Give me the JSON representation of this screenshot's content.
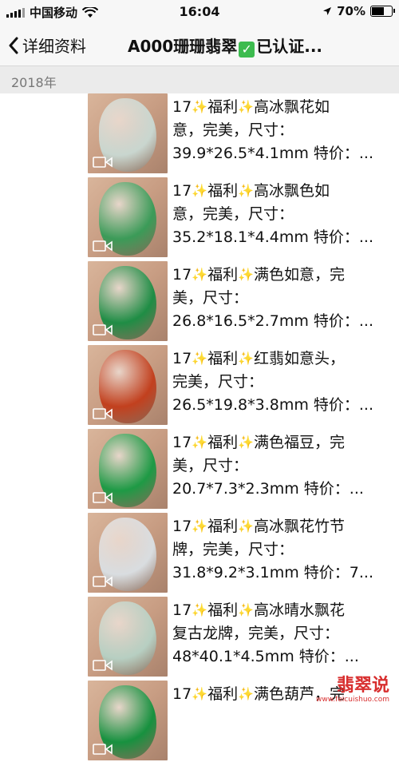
{
  "status_bar": {
    "carrier": "中国移动",
    "time": "16:04",
    "battery": "70%",
    "battery_level": 0.7
  },
  "nav": {
    "back_label": "详细资料",
    "title_prefix": "A000珊珊翡翠",
    "title_suffix": "已认证..."
  },
  "year": "2018年",
  "items": [
    {
      "lines": [
        "17",
        "福利",
        "高冰飘花如",
        "意，完美，尺寸：",
        "39.9*26.5*4.1mm 特价：..."
      ],
      "color": "#c9d6cf"
    },
    {
      "lines": [
        "17",
        "福利",
        "高冰飘色如",
        "意，完美，尺寸：",
        "35.2*18.1*4.4mm 特价：..."
      ],
      "color": "#3b9b58"
    },
    {
      "lines": [
        "17",
        "福利",
        "满色如意，完",
        "美，尺寸：",
        "26.8*16.5*2.7mm 特价：..."
      ],
      "color": "#1f8d45"
    },
    {
      "lines": [
        "17",
        "福利",
        "红翡如意头，",
        "完美，尺寸：",
        "26.5*19.8*3.8mm 特价：..."
      ],
      "color": "#c2401e"
    },
    {
      "lines": [
        "17",
        "福利",
        "满色福豆，完",
        "美，尺寸：",
        "20.7*7.3*2.3mm 特价：..."
      ],
      "color": "#1e9a45"
    },
    {
      "lines": [
        "17",
        "福利",
        "高冰飘花竹节",
        "牌，完美，尺寸：",
        "31.8*9.2*3.1mm 特价：7..."
      ],
      "color": "#d9dde0"
    },
    {
      "lines": [
        "17",
        "福利",
        "高冰晴水飘花",
        "复古龙牌，完美，尺寸：",
        "48*40.1*4.5mm 特价：..."
      ],
      "color": "#b7cfc2"
    },
    {
      "lines": [
        "17",
        "福利",
        "满色葫芦，完",
        "",
        ""
      ],
      "color": "#17913f"
    }
  ],
  "watermark": {
    "title": "翡翠说",
    "url": "www.feicuishuo.com"
  }
}
